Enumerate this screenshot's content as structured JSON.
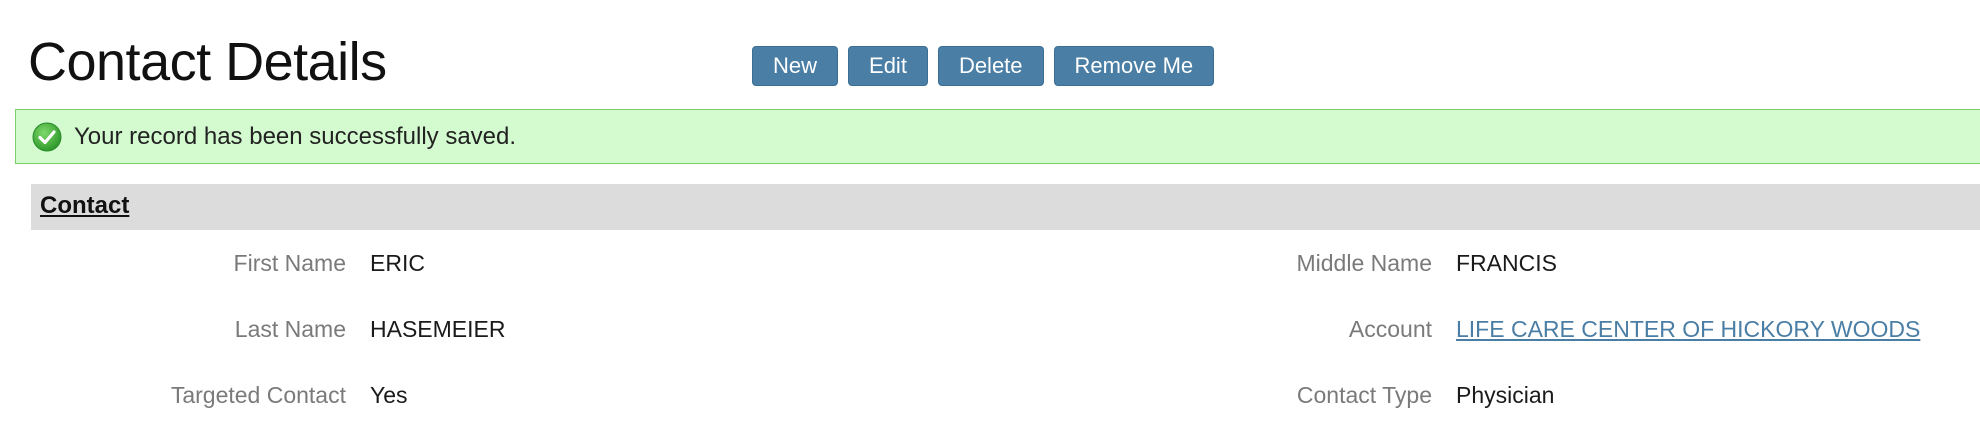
{
  "page": {
    "title": "Contact Details"
  },
  "toolbar": {
    "new_label": "New",
    "edit_label": "Edit",
    "delete_label": "Delete",
    "remove_me_label": "Remove Me"
  },
  "alert": {
    "icon": "success-check-icon",
    "message": "Your record has been successfully saved.",
    "colors": {
      "background": "#d4fbd0",
      "border": "#7fce6a",
      "icon": "#3aa635"
    }
  },
  "section": {
    "title": "Contact"
  },
  "fields": {
    "first_name": {
      "label": "First Name",
      "value": "ERIC"
    },
    "middle_name": {
      "label": "Middle Name",
      "value": "FRANCIS"
    },
    "last_name": {
      "label": "Last Name",
      "value": "HASEMEIER"
    },
    "account": {
      "label": "Account",
      "value": "LIFE CARE CENTER OF HICKORY WOODS"
    },
    "targeted_contact": {
      "label": "Targeted Contact",
      "value": "Yes"
    },
    "contact_type": {
      "label": "Contact Type",
      "value": "Physician"
    }
  },
  "colors": {
    "button": "#4a7ea5",
    "link": "#4a7ea5",
    "section_header": "#dcdcdc"
  }
}
